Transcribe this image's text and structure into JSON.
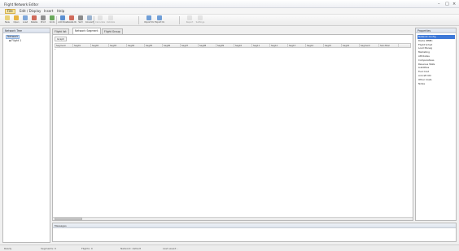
{
  "window": {
    "title": "Flight Network Editor",
    "controls": [
      "–",
      "□",
      "×"
    ]
  },
  "menu": [
    "File",
    "Edit / Display",
    "Insert",
    "Help"
  ],
  "toolbar": {
    "buttons": [
      {
        "label": "New",
        "icon": "new-file-icon",
        "color": "#e9d27a",
        "enabled": true
      },
      {
        "label": "Open",
        "icon": "open-folder-icon",
        "color": "#e7b443",
        "enabled": true
      },
      {
        "label": "Load",
        "icon": "load-icon",
        "color": "#7fa7d9",
        "enabled": true
      },
      {
        "label": "Delete",
        "icon": "delete-icon",
        "color": "#cf6a5a",
        "enabled": true
      },
      {
        "label": "Print",
        "icon": "print-icon",
        "color": "#8f8f8f",
        "enabled": true
      },
      {
        "label": "Undo",
        "icon": "undo-icon",
        "color": "#6aa85b",
        "enabled": true
      },
      {
        "label": "Add Row",
        "icon": "add-row-icon",
        "color": "#5b8fd1",
        "enabled": true
      },
      {
        "label": "Delete Row",
        "icon": "delete-row-icon",
        "color": "#cf6a5a",
        "enabled": true
      },
      {
        "label": "Sort",
        "icon": "sort-icon",
        "color": "#8c8c8c",
        "enabled": true
      },
      {
        "label": "Convert",
        "icon": "convert-icon",
        "color": "#9bb3cf",
        "enabled": true
      },
      {
        "label": "Calculate",
        "icon": "calculate-icon",
        "color": "#c9c9c9",
        "enabled": false
      },
      {
        "label": "Validate",
        "icon": "validate-icon",
        "color": "#c9c9c9",
        "enabled": false
      },
      {
        "label": "Import Data",
        "icon": "import-data-icon",
        "color": "#6f9ed7",
        "enabled": true
      },
      {
        "label": "Export Data",
        "icon": "export-data-icon",
        "color": "#6f9ed7",
        "enabled": true
      },
      {
        "label": "Report",
        "icon": "report-icon",
        "color": "#c9c9c9",
        "enabled": false
      },
      {
        "label": "Settings",
        "icon": "settings-icon",
        "color": "#c9c9c9",
        "enabled": false
      }
    ]
  },
  "left_panel": {
    "header": "Network Tree",
    "items": [
      {
        "label": "Network",
        "selected": true
      },
      {
        "label": "Flight 1",
        "selected": false
      }
    ]
  },
  "tabs": [
    {
      "label": "Flight list",
      "active": false
    },
    {
      "label": "Network Segment",
      "active": true
    },
    {
      "label": "Flight Group",
      "active": false
    }
  ],
  "subtab": "Graph",
  "grid": {
    "columns": [
      "Segment",
      "Seg01",
      "Seg02",
      "Seg03",
      "Seg04",
      "Seg05",
      "Seg06",
      "Seg07",
      "Seg08",
      "Seg09",
      "Seg10",
      "Seg11",
      "Seg12",
      "Seg13",
      "Seg14",
      "Seg15",
      "Seg16",
      "Segment",
      "Sub-Total"
    ],
    "row_marker": "*"
  },
  "message_panel": {
    "header": "Messages"
  },
  "right_panel": {
    "header": "Properties",
    "items": [
      {
        "label": "Network Config",
        "selected": true
      },
      {
        "label": "Route (BMB)",
        "selected": false
      },
      {
        "label": "Flight Sched",
        "selected": false
      },
      {
        "label": "Load Manag",
        "selected": false
      },
      {
        "label": "Marketing",
        "selected": false
      },
      {
        "label": "Attributes",
        "selected": false
      },
      {
        "label": "Comparatives",
        "selected": false
      },
      {
        "label": "Revenue Stats",
        "selected": false
      },
      {
        "label": "Liabilities",
        "selected": false
      },
      {
        "label": "Fuel Cost",
        "selected": false
      },
      {
        "label": "Aircraft Util",
        "selected": false
      },
      {
        "label": "Other Costs",
        "selected": false
      },
      {
        "label": "Notes",
        "selected": false
      }
    ]
  },
  "statusbar": [
    "Ready",
    "Segments: 0",
    "Flights: 0",
    "Network: default",
    "Last saved: -"
  ]
}
